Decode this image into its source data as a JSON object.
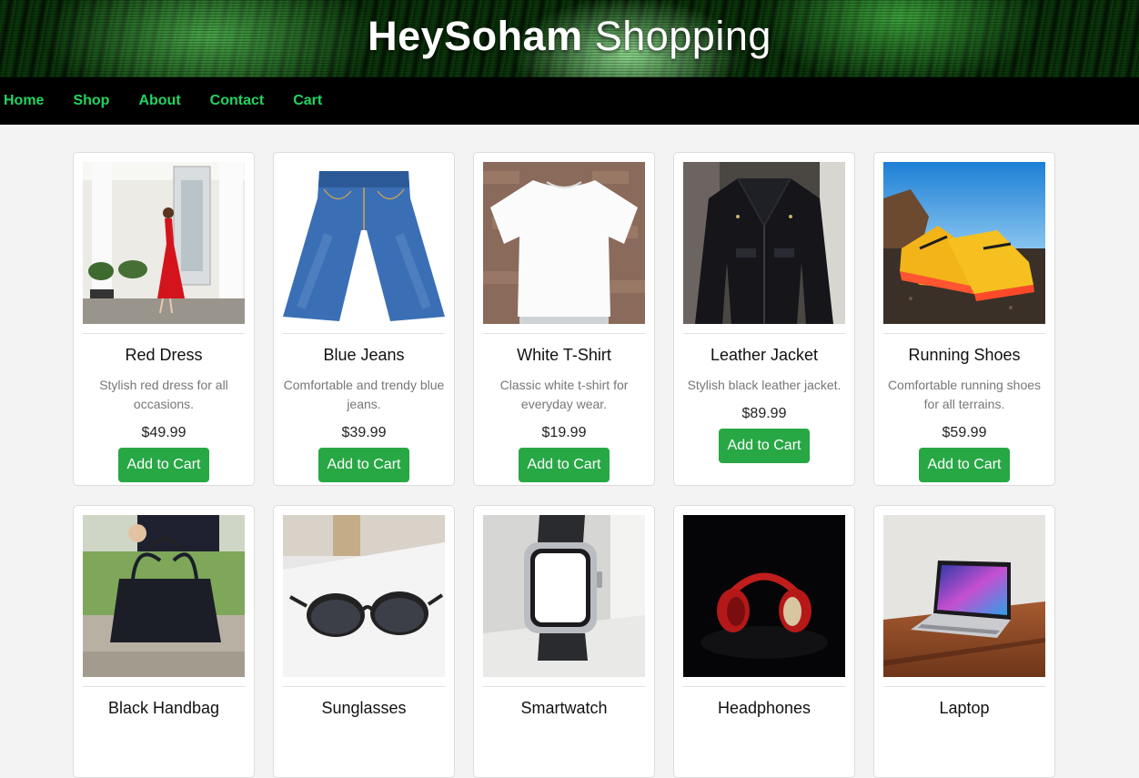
{
  "header": {
    "title_bold": "HeySoham",
    "title_light": "Shopping"
  },
  "nav": {
    "items": [
      "Home",
      "Shop",
      "About",
      "Contact",
      "Cart"
    ]
  },
  "products": [
    {
      "name": "Red Dress",
      "description": "Stylish red dress for all occasions.",
      "price": "$49.99",
      "button": "Add to Cart",
      "image": "red-dress-image"
    },
    {
      "name": "Blue Jeans",
      "description": "Comfortable and trendy blue jeans.",
      "price": "$39.99",
      "button": "Add to Cart",
      "image": "blue-jeans-image"
    },
    {
      "name": "White T-Shirt",
      "description": "Classic white t-shirt for everyday wear.",
      "price": "$19.99",
      "button": "Add to Cart",
      "image": "white-tshirt-image"
    },
    {
      "name": "Leather Jacket",
      "description": "Stylish black leather jacket.",
      "price": "$89.99",
      "button": "Add to Cart",
      "image": "leather-jacket-image"
    },
    {
      "name": "Running Shoes",
      "description": "Comfortable running shoes for all terrains.",
      "price": "$59.99",
      "button": "Add to Cart",
      "image": "running-shoes-image"
    },
    {
      "name": "Black Handbag",
      "image": "black-handbag-image"
    },
    {
      "name": "Sunglasses",
      "image": "sunglasses-image"
    },
    {
      "name": "Smartwatch",
      "image": "smartwatch-image"
    },
    {
      "name": "Headphones",
      "image": "headphones-image"
    },
    {
      "name": "Laptop",
      "image": "laptop-image"
    }
  ],
  "colors": {
    "nav_bg": "#000000",
    "nav_link": "#22d462",
    "button_bg": "#28a745",
    "page_bg": "#f3f3f3"
  }
}
